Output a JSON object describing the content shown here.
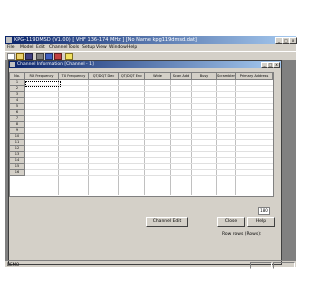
{
  "app": {
    "title": "KPG-119DMSD (V1.00) [ VHF 136-174 MHz ] [No Name kpg119dmsd.dat]",
    "window_buttons": [
      "_",
      "□",
      "x"
    ]
  },
  "menu": [
    "File",
    "Model",
    "Edit",
    "Channel",
    "Tools",
    "Setup",
    "View",
    "Window",
    "Help"
  ],
  "toolbar": [
    "new-icon",
    "open-icon",
    "save-icon",
    "print-icon",
    "read-icon",
    "write-icon",
    "help-icon"
  ],
  "child_window": {
    "title": "Channel Information [Channel - 1]",
    "window_buttons": [
      "_",
      "□",
      "x"
    ]
  },
  "table": {
    "columns": [
      "No.",
      "RX Frequency",
      "TX Frequency",
      "QT/DQT Dec",
      "QT/DQT Enc",
      "Wide",
      "Scan Add",
      "Busy",
      "Scrambler",
      "Primary Address"
    ],
    "rows": [
      "1",
      "2",
      "3",
      "4",
      "5",
      "6",
      "7",
      "8",
      "9",
      "10",
      "11",
      "12",
      "13",
      "14",
      "15",
      "16"
    ]
  },
  "footer": {
    "rows_label": "Row rows (Rows):",
    "rows_value": "180",
    "channel_edit_button": "Channel Edit",
    "close_button": "Close",
    "help_button": "Help"
  },
  "status": "DEMO"
}
